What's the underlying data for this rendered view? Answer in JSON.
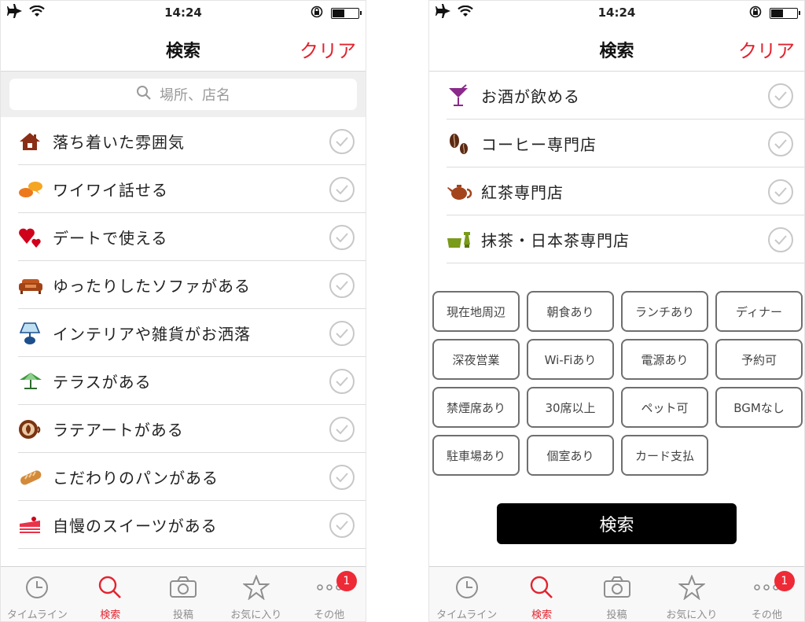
{
  "status": {
    "time": "14:24",
    "battery_level": 0.45
  },
  "nav": {
    "title": "検索",
    "clear_label": "クリア"
  },
  "search": {
    "placeholder": "場所、店名"
  },
  "left_list": [
    {
      "label": "落ち着いた雰囲気",
      "icon": "house-icon"
    },
    {
      "label": "ワイワイ話せる",
      "icon": "speech-bubbles-icon"
    },
    {
      "label": "デートで使える",
      "icon": "hearts-icon"
    },
    {
      "label": "ゆったりしたソファがある",
      "icon": "sofa-icon"
    },
    {
      "label": "インテリアや雑貨がお洒落",
      "icon": "lamp-icon"
    },
    {
      "label": "テラスがある",
      "icon": "parasol-icon"
    },
    {
      "label": "ラテアートがある",
      "icon": "latte-art-icon"
    },
    {
      "label": "こだわりのパンがある",
      "icon": "bread-icon"
    },
    {
      "label": "自慢のスイーツがある",
      "icon": "cake-icon"
    }
  ],
  "right_list": [
    {
      "label": "お酒が飲める",
      "icon": "cocktail-icon"
    },
    {
      "label": "コーヒー専門店",
      "icon": "coffee-beans-icon"
    },
    {
      "label": "紅茶専門店",
      "icon": "teapot-icon"
    },
    {
      "label": "抹茶・日本茶専門店",
      "icon": "matcha-icon"
    }
  ],
  "chips": [
    "現在地周辺",
    "朝食あり",
    "ランチあり",
    "ディナー",
    "深夜営業",
    "Wi-Fiあり",
    "電源あり",
    "予約可",
    "禁煙席あり",
    "30席以上",
    "ペット可",
    "BGMなし",
    "駐車場あり",
    "個室あり",
    "カード支払"
  ],
  "search_button": "検索",
  "tabs": [
    {
      "label": "タイムライン",
      "icon": "clock-icon",
      "active": false
    },
    {
      "label": "検索",
      "icon": "search-icon",
      "active": true
    },
    {
      "label": "投稿",
      "icon": "camera-icon",
      "active": false
    },
    {
      "label": "お気に入り",
      "icon": "star-icon",
      "active": false
    },
    {
      "label": "その他",
      "icon": "more-dots-icon",
      "active": false,
      "badge": "1"
    }
  ],
  "colors": {
    "accent": "#e2242f",
    "badge": "#ee2a36",
    "divider": "#dcdcdc",
    "chip_border": "#6f6f6f"
  }
}
